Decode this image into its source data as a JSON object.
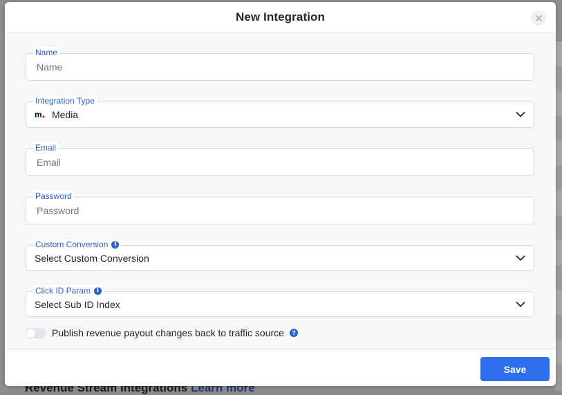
{
  "background": {
    "footer_text": "Revenue Stream Integrations",
    "footer_link": "Learn more"
  },
  "modal": {
    "title": "New Integration",
    "close_icon": "close-icon",
    "fields": {
      "name": {
        "label": "Name",
        "placeholder": "Name",
        "value": ""
      },
      "integration_type": {
        "label": "Integration Type",
        "value": "Media",
        "icon": "media-logo-icon"
      },
      "email": {
        "label": "Email",
        "placeholder": "Email",
        "value": ""
      },
      "password": {
        "label": "Password",
        "placeholder": "Password",
        "value": ""
      },
      "custom_conversion": {
        "label": "Custom Conversion",
        "value": "Select Custom Conversion",
        "info_icon": "info-icon"
      },
      "click_id_param": {
        "label": "Click ID Param",
        "value": "Select Sub ID Index",
        "info_icon": "info-icon"
      }
    },
    "toggle": {
      "label": "Publish revenue payout changes back to traffic source",
      "checked": false,
      "help_icon": "question-icon"
    },
    "save_label": "Save"
  },
  "colors": {
    "accent": "#2f6fed",
    "label": "#2a63c7",
    "brand_m": "#e0245e"
  }
}
